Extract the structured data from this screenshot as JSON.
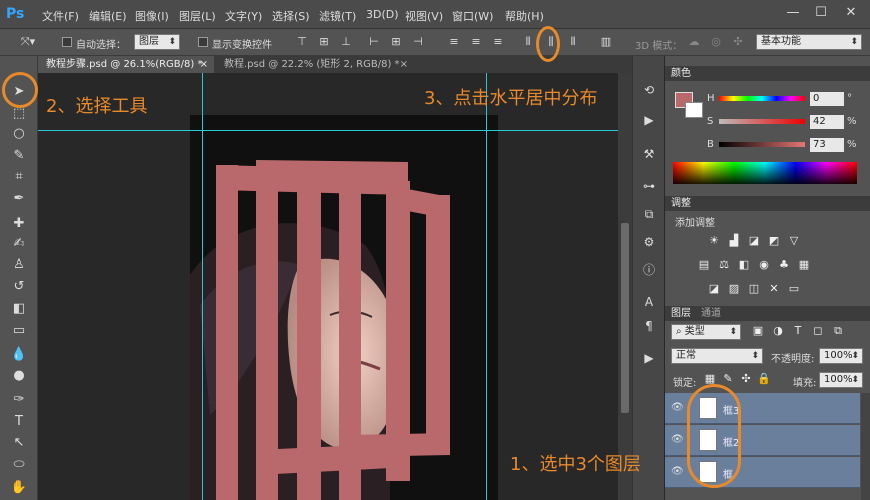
{
  "app": {
    "logo": "Ps"
  },
  "menu": [
    "文件(F)",
    "编辑(E)",
    "图像(I)",
    "图层(L)",
    "文字(Y)",
    "选择(S)",
    "滤镜(T)",
    "3D(D)",
    "视图(V)",
    "窗口(W)",
    "帮助(H)"
  ],
  "window_buttons": {
    "minimize": "—",
    "maximize": "☐",
    "close": "✕"
  },
  "options_bar": {
    "auto_select_label": "自动选择：",
    "auto_select_value": "图层",
    "show_transform_label": "显示变换控件",
    "mode_3d_label": "3D 模式：",
    "workspace_value": "基本功能"
  },
  "tabs": [
    {
      "label": "教程步骤.psd @ 26.1%(RGB/8) *",
      "close": "×"
    },
    {
      "label": "教程.psd @ 22.2% (矩形 2, RGB/8) *",
      "close": "×"
    }
  ],
  "color_panel": {
    "title": "颜色",
    "channels": [
      {
        "label": "H",
        "value": "0",
        "unit": "°"
      },
      {
        "label": "S",
        "value": "42",
        "unit": "%"
      },
      {
        "label": "B",
        "value": "73",
        "unit": "%"
      }
    ],
    "foreground_color": "#b9696b"
  },
  "adjustments_panel": {
    "title": "调整",
    "add_label": "添加调整"
  },
  "layers_panel": {
    "tabs": [
      "图层",
      "通道"
    ],
    "filter_value": "类型",
    "blend_mode": "正常",
    "opacity_label": "不透明度:",
    "opacity_value": "100%",
    "lock_label": "锁定:",
    "fill_label": "填充:",
    "fill_value": "100%",
    "layers": [
      {
        "name": "框3"
      },
      {
        "name": "框2"
      },
      {
        "name": "框"
      }
    ]
  },
  "annotations": {
    "step1": "1、选中3个图层",
    "step2": "2、选择工具",
    "step3": "3、点击水平居中分布"
  },
  "colors": {
    "accent": "#e8892a",
    "guide": "#27c8d6",
    "frame": "#b9696b",
    "selected_layer": "#6a7f9c"
  }
}
